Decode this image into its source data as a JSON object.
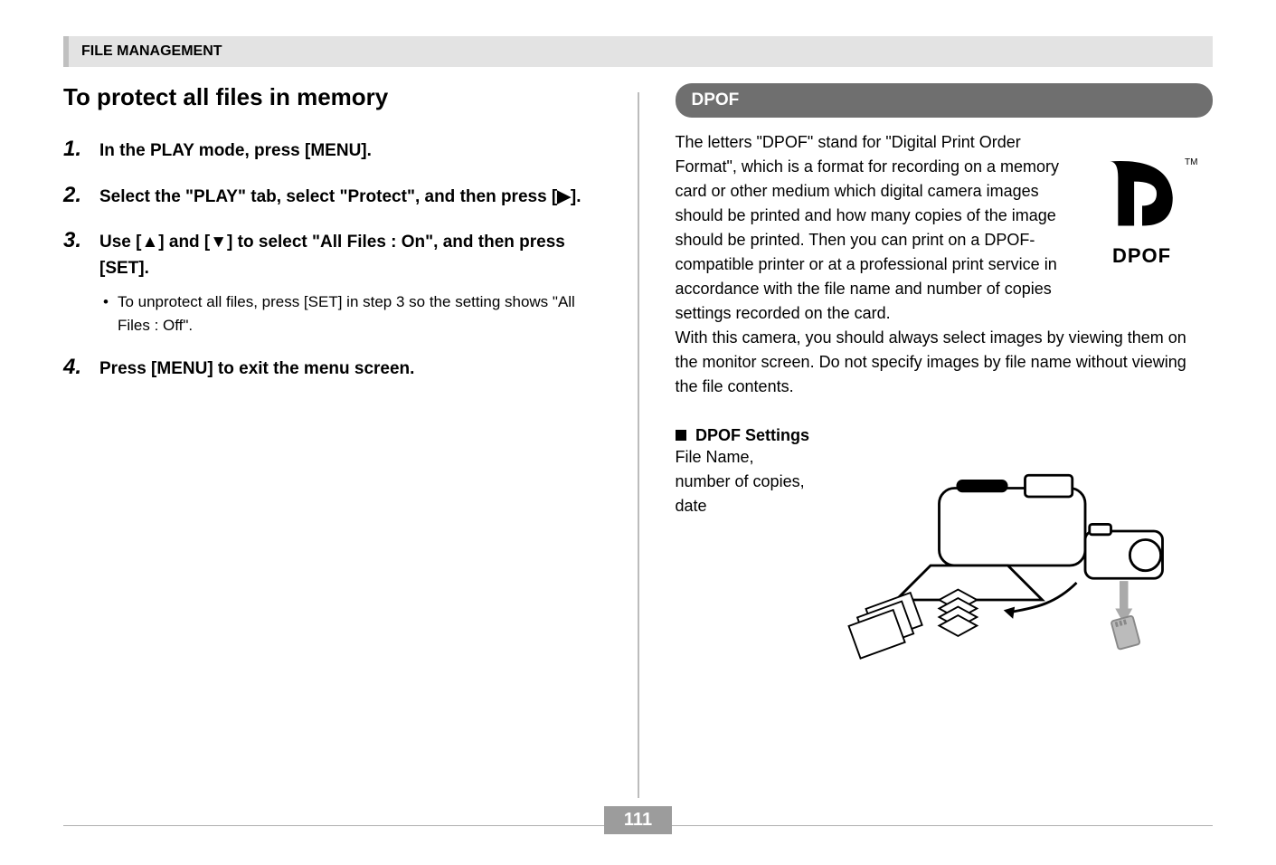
{
  "section_header": "FILE MANAGEMENT",
  "left": {
    "title": "To protect all files in memory",
    "steps": [
      {
        "num": "1.",
        "text": "In the PLAY mode, press [MENU]."
      },
      {
        "num": "2.",
        "text": "Select the \"PLAY\" tab, select \"Protect\", and then press [▶]."
      },
      {
        "num": "3.",
        "text": "Use [▲] and [▼] to select \"All Files : On\", and then press [SET].",
        "sub": "To unprotect all files, press [SET] in step 3 so the setting shows \"All Files : Off\"."
      },
      {
        "num": "4.",
        "text": "Press [MENU] to exit the menu screen."
      }
    ]
  },
  "right": {
    "heading": "DPOF",
    "para1": "The letters \"DPOF\" stand for \"Digital Print Order Format\", which is a format for recording on a memory card or other medium which digital camera images should be printed and how many copies of the image should be printed. Then you can print on a DPOF-compatible printer or at a professional print service in accordance with the file name and number of copies settings recorded on the card.",
    "para2": "With this camera, you should always select images by viewing them on the monitor screen. Do not specify images by file name without viewing the file contents.",
    "logo_text": "DPOF",
    "tm": "TM",
    "settings_title": "DPOF Settings",
    "settings_items": "File Name,\nnumber of copies,\ndate"
  },
  "page_number": "111"
}
